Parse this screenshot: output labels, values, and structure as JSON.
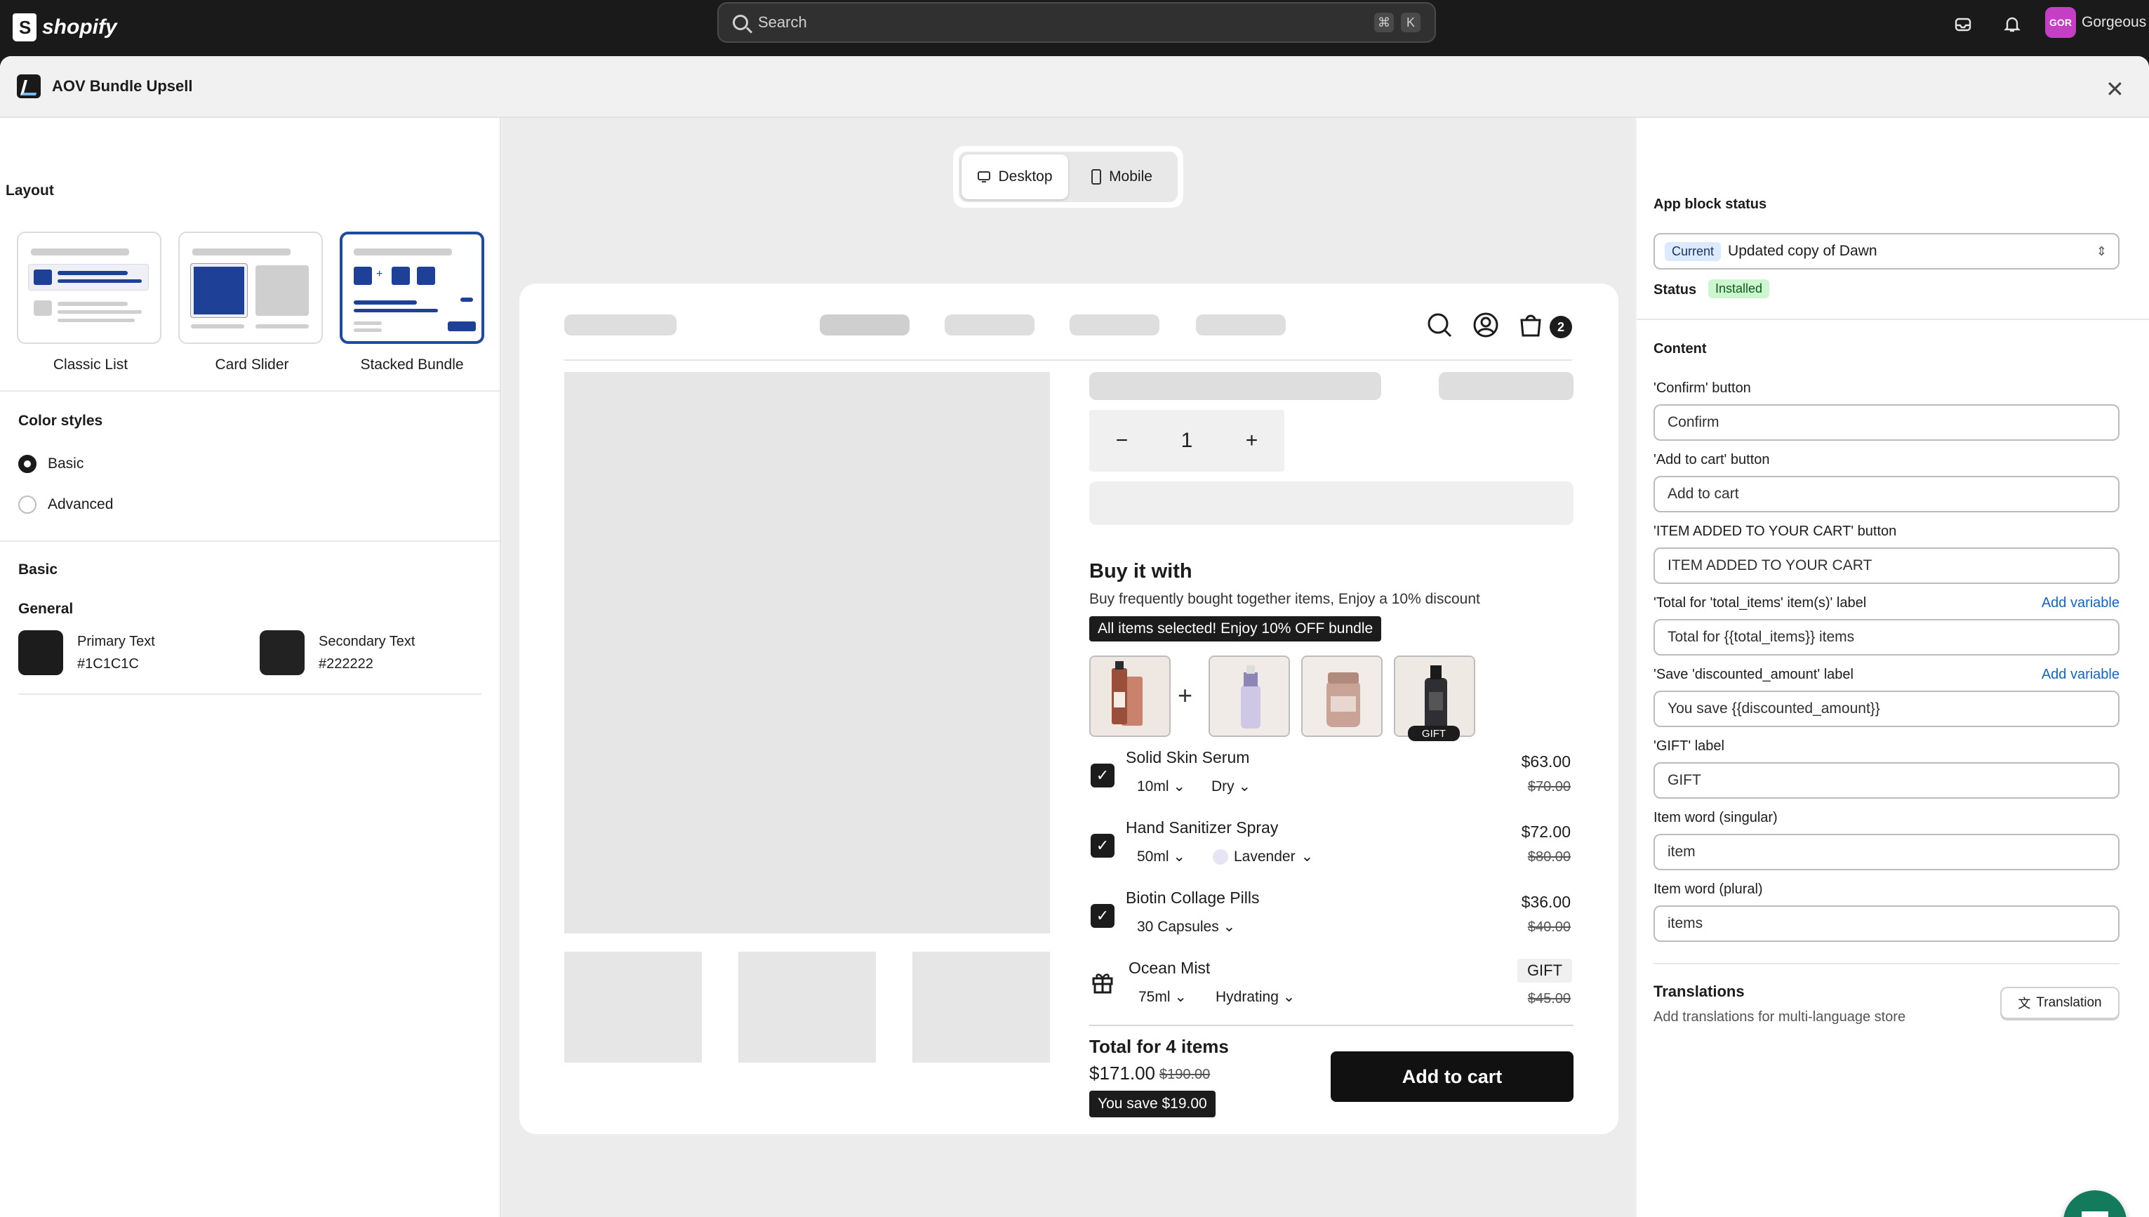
{
  "topbar": {
    "brand": "shopify",
    "search_placeholder": "Search",
    "kbd1": "⌘",
    "kbd2": "K",
    "avatar_initials": "GOR",
    "store_name": "Gorgeous"
  },
  "modal": {
    "title": "AOV Bundle Upsell",
    "close": "✕"
  },
  "left": {
    "layout_title": "Layout",
    "layouts": [
      "Classic List",
      "Card Slider",
      "Stacked Bundle"
    ],
    "selected_layout": "Stacked Bundle",
    "color_styles_title": "Color styles",
    "color_options": [
      "Basic",
      "Advanced"
    ],
    "selected_color_option": "Basic",
    "basic_title": "Basic",
    "general_title": "General",
    "primary_label": "Primary Text",
    "primary_value": "#1C1C1C",
    "secondary_label": "Secondary Text",
    "secondary_value": "#222222",
    "colors": {
      "primary": "#1C1C1C",
      "secondary": "#222222",
      "accent": "#1E4AA0"
    }
  },
  "preview": {
    "tabs": [
      "Desktop",
      "Mobile"
    ],
    "active_tab": "Desktop",
    "cart_count": "2",
    "quantity": "1",
    "minus": "−",
    "plus": "+",
    "bundle_title": "Buy it with",
    "bundle_subtitle": "Buy frequently bought together items, Enjoy a 10% discount",
    "selected_badge": "All items selected! Enjoy 10% OFF bundle",
    "gift_tag": "GIFT",
    "items": [
      {
        "name": "Solid Skin Serum",
        "opt1": "10ml",
        "opt2": "Dry",
        "price": "$63.00",
        "old": "$70.00"
      },
      {
        "name": "Hand Sanitizer Spray",
        "opt1": "50ml",
        "opt2": "Lavender",
        "price": "$72.00",
        "old": "$80.00"
      },
      {
        "name": "Biotin Collage Pills",
        "opt1": "30 Capsules",
        "opt2": "",
        "price": "$36.00",
        "old": "$40.00"
      },
      {
        "name": "Ocean Mist",
        "opt1": "75ml",
        "opt2": "Hydrating",
        "price": "GIFT",
        "old": "$45.00"
      }
    ],
    "total_label": "Total for 4 items",
    "total_price": "$171.00",
    "total_old": "$190.00",
    "save_badge": "You save $19.00",
    "add_to_cart": "Add to cart"
  },
  "right": {
    "status_title": "App block status",
    "theme_badge": "Current",
    "theme_name": "Updated copy of Dawn",
    "status_label": "Status",
    "status_value": "Installed",
    "content_title": "Content",
    "add_variable": "Add variable",
    "fields": [
      {
        "label": "'Confirm' button",
        "value": "Confirm"
      },
      {
        "label": "'Add to cart' button",
        "value": "Add to cart"
      },
      {
        "label": "'ITEM ADDED TO YOUR CART' button",
        "value": "ITEM ADDED TO YOUR CART"
      },
      {
        "label": "'Total for 'total_items' item(s)' label",
        "value": "Total for {{total_items}} items"
      },
      {
        "label": "'Save 'discounted_amount' label",
        "value": "You save {{discounted_amount}}"
      },
      {
        "label": "'GIFT' label",
        "value": "GIFT"
      },
      {
        "label": "Item word (singular)",
        "value": "item"
      },
      {
        "label": "Item word (plural)",
        "value": "items"
      }
    ],
    "translations_title": "Translations",
    "translations_sub": "Add translations for multi-language store",
    "translation_button": "Translation"
  }
}
